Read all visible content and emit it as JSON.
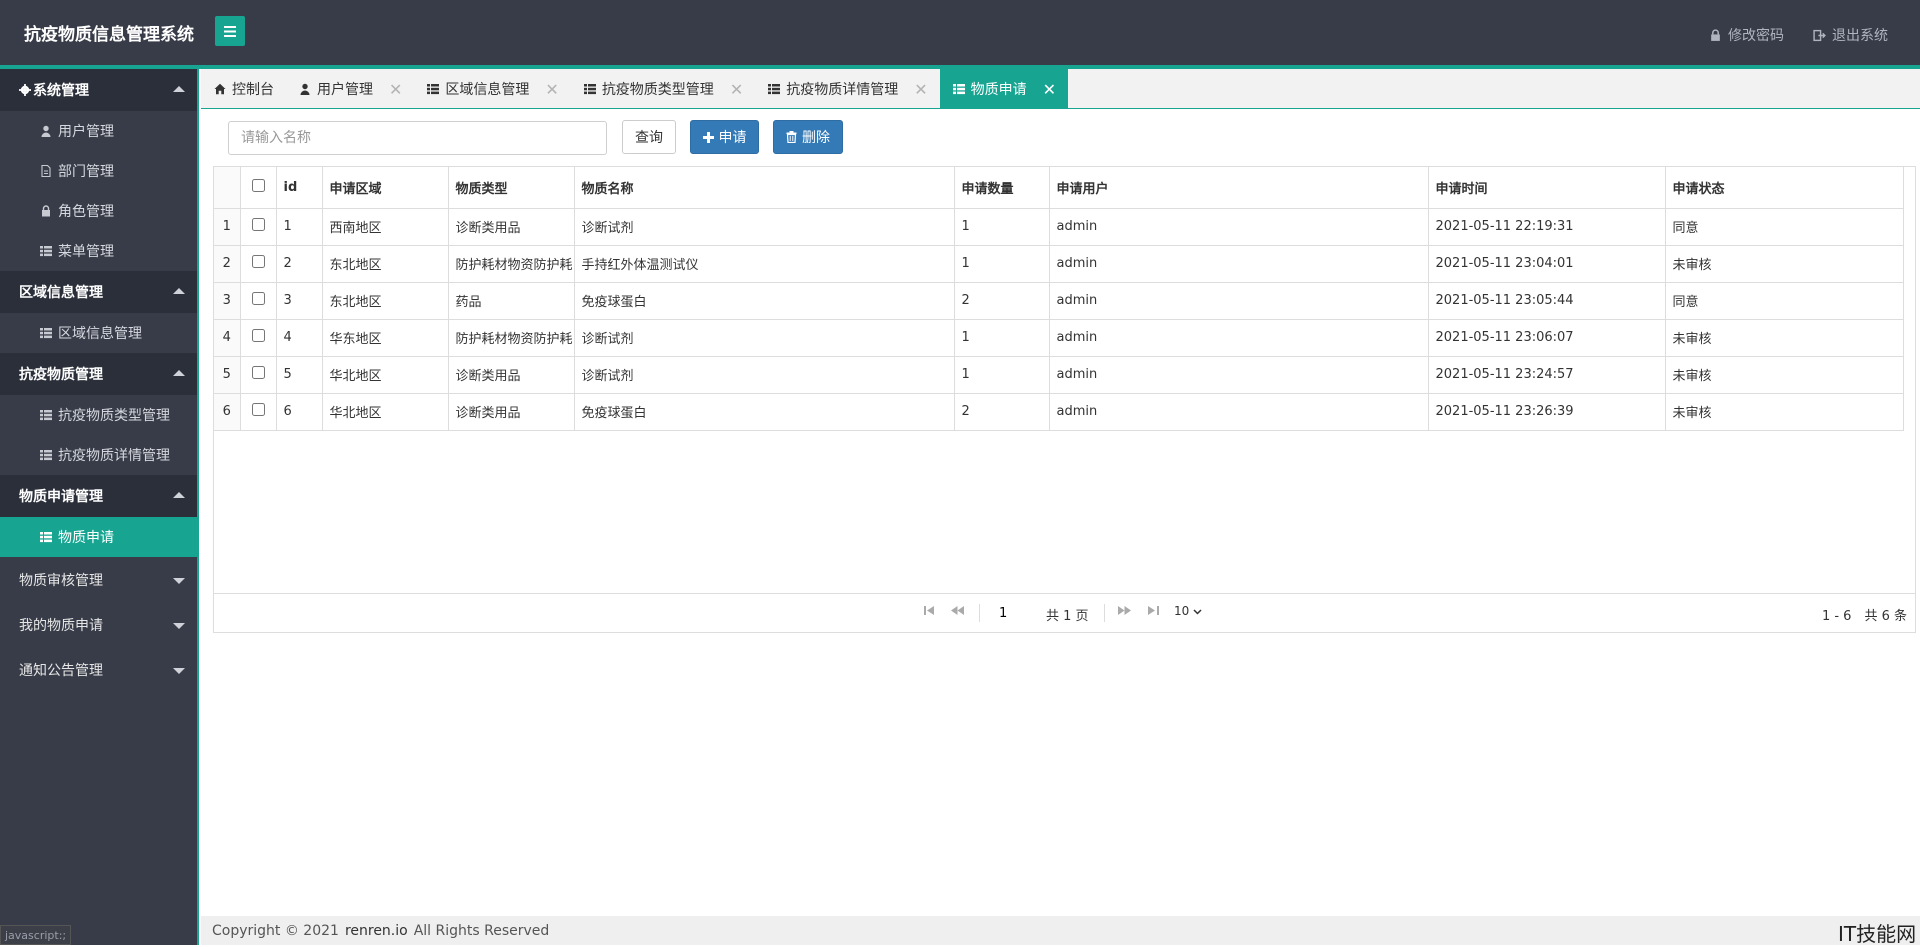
{
  "header": {
    "title": "抗疫物质信息管理系统",
    "change_password": "修改密码",
    "logout": "退出系统"
  },
  "sidebar": {
    "groups": [
      {
        "label": "系统管理",
        "icon": "gear-icon",
        "expanded": true,
        "items": [
          {
            "label": "用户管理",
            "icon": "user-icon"
          },
          {
            "label": "部门管理",
            "icon": "file-icon"
          },
          {
            "label": "角色管理",
            "icon": "lock-icon"
          },
          {
            "label": "菜单管理",
            "icon": "list-icon"
          }
        ]
      },
      {
        "label": "区域信息管理",
        "expanded": true,
        "items": [
          {
            "label": "区域信息管理",
            "icon": "list-icon"
          }
        ]
      },
      {
        "label": "抗疫物质管理",
        "expanded": true,
        "items": [
          {
            "label": "抗疫物质类型管理",
            "icon": "list-icon"
          },
          {
            "label": "抗疫物质详情管理",
            "icon": "list-icon"
          }
        ]
      },
      {
        "label": "物质申请管理",
        "expanded": true,
        "items": [
          {
            "label": "物质申请",
            "icon": "list-icon",
            "active": true
          }
        ]
      },
      {
        "label": "物质审核管理",
        "expanded": false
      },
      {
        "label": "我的物质申请",
        "expanded": false
      },
      {
        "label": "通知公告管理",
        "expanded": false
      }
    ]
  },
  "tabs": [
    {
      "label": "控制台",
      "icon": "home-icon",
      "closable": false
    },
    {
      "label": "用户管理",
      "icon": "user-icon",
      "closable": true
    },
    {
      "label": "区域信息管理",
      "icon": "list-icon",
      "closable": true
    },
    {
      "label": "抗疫物质类型管理",
      "icon": "list-icon",
      "closable": true
    },
    {
      "label": "抗疫物质详情管理",
      "icon": "list-icon",
      "closable": true
    },
    {
      "label": "物质申请",
      "icon": "list-icon",
      "closable": true,
      "active": true
    }
  ],
  "toolbar": {
    "search_placeholder": "请输入名称",
    "query_label": "查询",
    "apply_label": "申请",
    "delete_label": "删除"
  },
  "table": {
    "columns": [
      "id",
      "申请区域",
      "物质类型",
      "物质名称",
      "申请数量",
      "申请用户",
      "申请时间",
      "申请状态"
    ],
    "rows": [
      {
        "rownum": "1",
        "id": "1",
        "region": "西南地区",
        "type": "诊断类用品",
        "name": "诊断试剂",
        "qty": "1",
        "user": "admin",
        "time": "2021-05-11 22:19:31",
        "status": "同意"
      },
      {
        "rownum": "2",
        "id": "2",
        "region": "东北地区",
        "type": "防护耗材物资防护耗",
        "name": "手持红外体温测试仪",
        "qty": "1",
        "user": "admin",
        "time": "2021-05-11 23:04:01",
        "status": "未审核"
      },
      {
        "rownum": "3",
        "id": "3",
        "region": "东北地区",
        "type": "药品",
        "name": "免疫球蛋白",
        "qty": "2",
        "user": "admin",
        "time": "2021-05-11 23:05:44",
        "status": "同意"
      },
      {
        "rownum": "4",
        "id": "4",
        "region": "华东地区",
        "type": "防护耗材物资防护耗",
        "name": "诊断试剂",
        "qty": "1",
        "user": "admin",
        "time": "2021-05-11 23:06:07",
        "status": "未审核"
      },
      {
        "rownum": "5",
        "id": "5",
        "region": "华北地区",
        "type": "诊断类用品",
        "name": "诊断试剂",
        "qty": "1",
        "user": "admin",
        "time": "2021-05-11 23:24:57",
        "status": "未审核"
      },
      {
        "rownum": "6",
        "id": "6",
        "region": "华北地区",
        "type": "诊断类用品",
        "name": "免疫球蛋白",
        "qty": "2",
        "user": "admin",
        "time": "2021-05-11 23:26:39",
        "status": "未审核"
      }
    ]
  },
  "pager": {
    "page": "1",
    "total_pages": "共 1 页",
    "page_size": "10",
    "info": "1 - 6　共 6 条"
  },
  "footer": {
    "copyright": "Copyright © 2021",
    "site": "renren.io",
    "rights": "All Rights Reserved"
  },
  "status_tip": "javascript:;",
  "watermark": "IT技能网",
  "colors": {
    "accent": "#17a592",
    "dark": "#383c48",
    "primary": "#337ab7"
  }
}
